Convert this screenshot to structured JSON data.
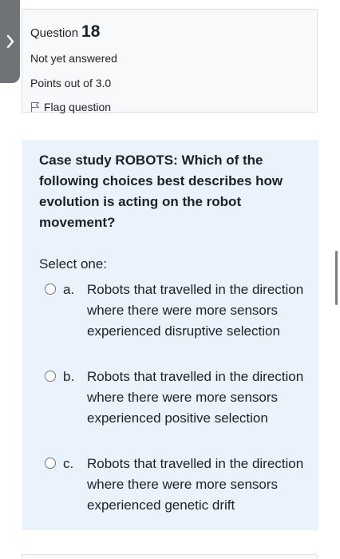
{
  "question_info": {
    "label": "Question",
    "number": "18",
    "state": "Not yet answered",
    "grade": "Points out of 3.0",
    "flag_label": "Flag question"
  },
  "question": {
    "text": "Case study ROBOTS: Which of the following choices best describes how evolution is acting on the robot movement?",
    "prompt": "Select one:",
    "options": [
      {
        "letter": "a.",
        "text": "Robots that travelled in the direction where there were more sensors experienced disruptive selection",
        "selected": false
      },
      {
        "letter": "b.",
        "text": "Robots that travelled in the direction where there were more sensors experienced positive selection",
        "selected": false
      },
      {
        "letter": "c.",
        "text": "Robots that travelled in the direction where there were more sensors experienced genetic drift",
        "selected": false
      }
    ]
  },
  "icons": {
    "drawer_toggle": "chevron-right-icon",
    "flag": "flag-outline-icon"
  },
  "colors": {
    "drawer_tab": "#6f7377",
    "info_background": "#f8f9fa",
    "content_background": "#eaf3fb",
    "text": "#1d2125"
  }
}
